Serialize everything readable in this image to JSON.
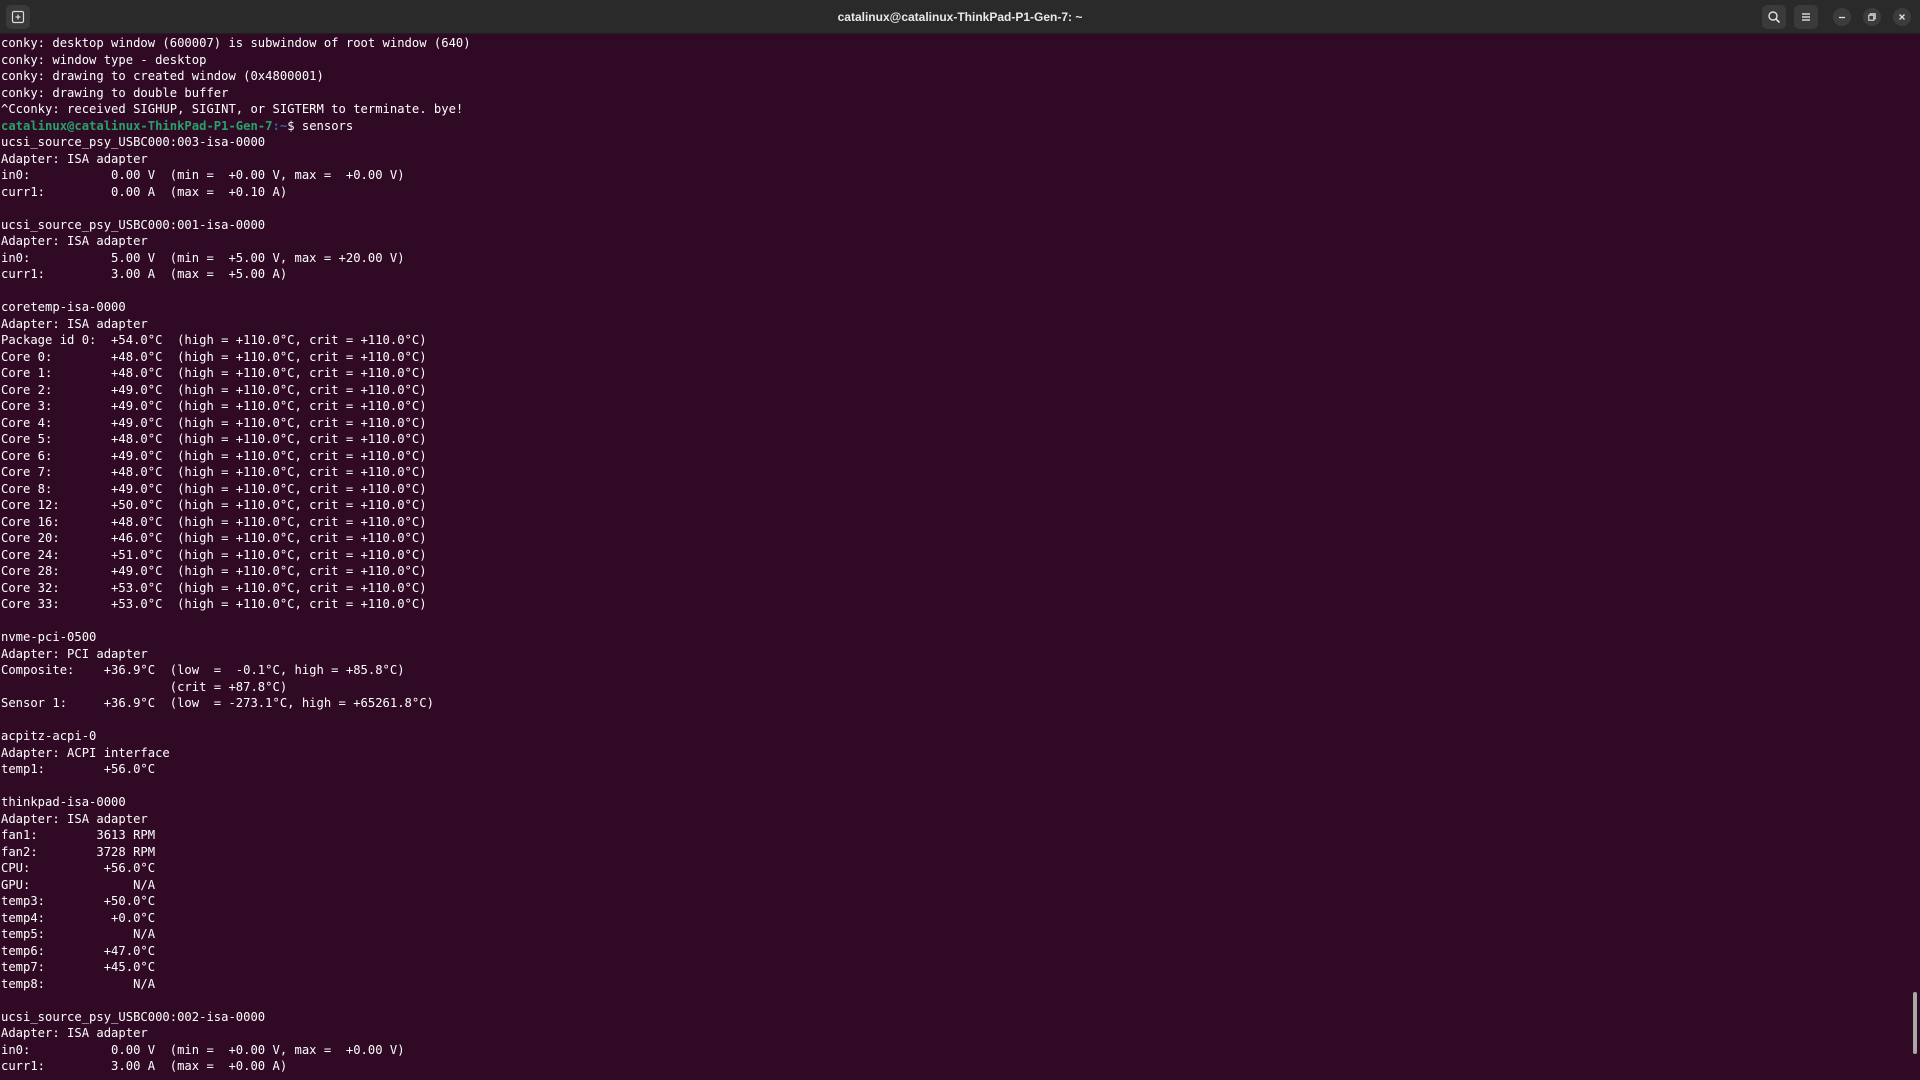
{
  "window": {
    "title": "catalinux@catalinux-ThinkPad-P1-Gen-7: ~",
    "icons": {
      "new_tab": "new-tab-icon",
      "search": "search-icon",
      "menu": "hamburger-menu-icon",
      "minimize": "minimize-icon",
      "maximize": "maximize-icon",
      "close": "close-icon"
    }
  },
  "colors": {
    "background": "#300a24",
    "prompt_user": "#26a269",
    "prompt_path": "#3465a4",
    "text": "#ffffff"
  },
  "terminal": {
    "pre_lines": [
      "conky: desktop window (600007) is subwindow of root window (640)",
      "conky: window type - desktop",
      "conky: drawing to created window (0x4800001)",
      "conky: drawing to double buffer",
      "^Cconky: received SIGHUP, SIGINT, or SIGTERM to terminate. bye!"
    ],
    "prompt": {
      "user_host": "catalinux@catalinux-ThinkPad-P1-Gen-7",
      "path": ":~",
      "symbol": "$ ",
      "command": "sensors"
    },
    "post_lines": [
      "ucsi_source_psy_USBC000:003-isa-0000",
      "Adapter: ISA adapter",
      "in0:           0.00 V  (min =  +0.00 V, max =  +0.00 V)",
      "curr1:         0.00 A  (max =  +0.10 A)",
      "",
      "ucsi_source_psy_USBC000:001-isa-0000",
      "Adapter: ISA adapter",
      "in0:           5.00 V  (min =  +5.00 V, max = +20.00 V)",
      "curr1:         3.00 A  (max =  +5.00 A)",
      "",
      "coretemp-isa-0000",
      "Adapter: ISA adapter",
      "Package id 0:  +54.0°C  (high = +110.0°C, crit = +110.0°C)",
      "Core 0:        +48.0°C  (high = +110.0°C, crit = +110.0°C)",
      "Core 1:        +48.0°C  (high = +110.0°C, crit = +110.0°C)",
      "Core 2:        +49.0°C  (high = +110.0°C, crit = +110.0°C)",
      "Core 3:        +49.0°C  (high = +110.0°C, crit = +110.0°C)",
      "Core 4:        +49.0°C  (high = +110.0°C, crit = +110.0°C)",
      "Core 5:        +48.0°C  (high = +110.0°C, crit = +110.0°C)",
      "Core 6:        +49.0°C  (high = +110.0°C, crit = +110.0°C)",
      "Core 7:        +48.0°C  (high = +110.0°C, crit = +110.0°C)",
      "Core 8:        +49.0°C  (high = +110.0°C, crit = +110.0°C)",
      "Core 12:       +50.0°C  (high = +110.0°C, crit = +110.0°C)",
      "Core 16:       +48.0°C  (high = +110.0°C, crit = +110.0°C)",
      "Core 20:       +46.0°C  (high = +110.0°C, crit = +110.0°C)",
      "Core 24:       +51.0°C  (high = +110.0°C, crit = +110.0°C)",
      "Core 28:       +49.0°C  (high = +110.0°C, crit = +110.0°C)",
      "Core 32:       +53.0°C  (high = +110.0°C, crit = +110.0°C)",
      "Core 33:       +53.0°C  (high = +110.0°C, crit = +110.0°C)",
      "",
      "nvme-pci-0500",
      "Adapter: PCI adapter",
      "Composite:    +36.9°C  (low  =  -0.1°C, high = +85.8°C)",
      "                       (crit = +87.8°C)",
      "Sensor 1:     +36.9°C  (low  = -273.1°C, high = +65261.8°C)",
      "",
      "acpitz-acpi-0",
      "Adapter: ACPI interface",
      "temp1:        +56.0°C",
      "",
      "thinkpad-isa-0000",
      "Adapter: ISA adapter",
      "fan1:        3613 RPM",
      "fan2:        3728 RPM",
      "CPU:          +56.0°C",
      "GPU:              N/A",
      "temp3:        +50.0°C",
      "temp4:         +0.0°C",
      "temp5:            N/A",
      "temp6:        +47.0°C",
      "temp7:        +45.0°C",
      "temp8:            N/A",
      "",
      "ucsi_source_psy_USBC000:002-isa-0000",
      "Adapter: ISA adapter",
      "in0:           0.00 V  (min =  +0.00 V, max =  +0.00 V)",
      "curr1:         3.00 A  (max =  +0.00 A)"
    ]
  }
}
